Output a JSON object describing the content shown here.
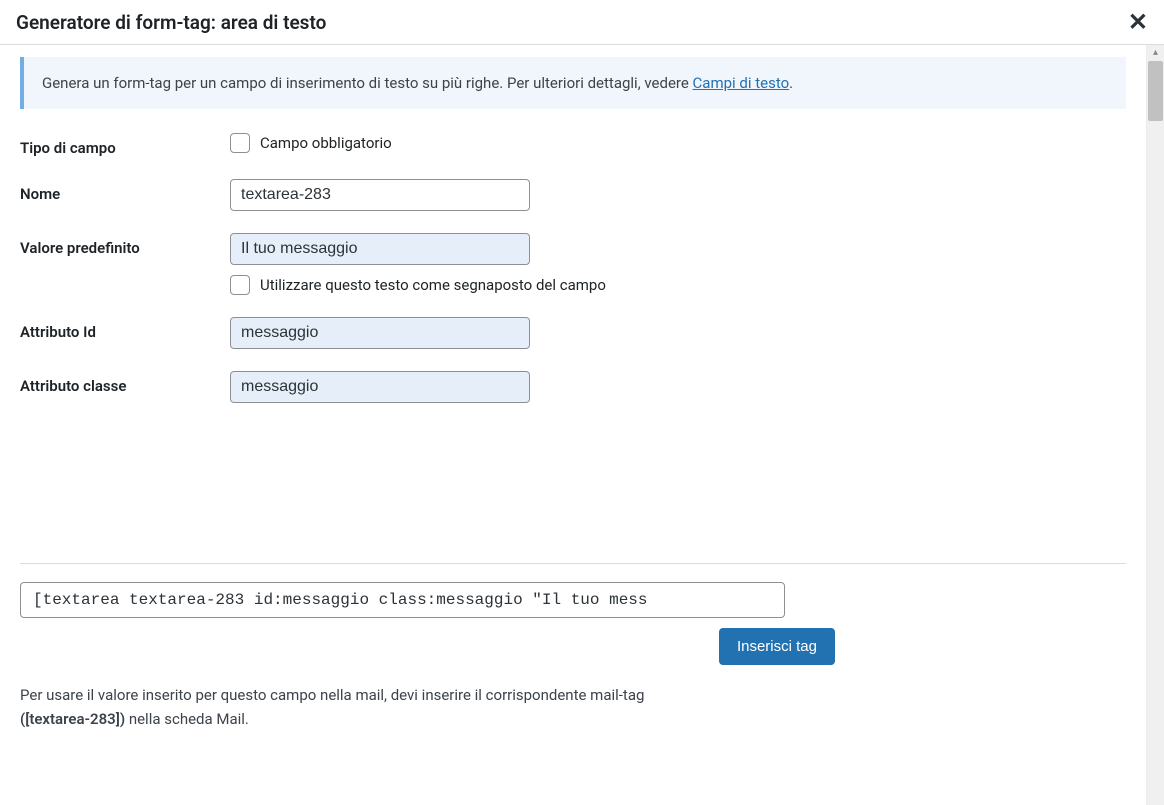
{
  "header": {
    "title": "Generatore di form-tag: area di testo"
  },
  "info": {
    "text_before_link": "Genera un form-tag per un campo di inserimento di testo su più righe. Per ulteriori dettagli, vedere ",
    "link_text": "Campi di testo",
    "text_after_link": "."
  },
  "fields": {
    "field_type": {
      "label": "Tipo di campo",
      "checkbox_label": "Campo obbligatorio"
    },
    "name": {
      "label": "Nome",
      "value": "textarea-283"
    },
    "default_value": {
      "label": "Valore predefinito",
      "value": "Il tuo messaggio",
      "placeholder_checkbox_label": "Utilizzare questo testo come segnaposto del campo"
    },
    "id_attr": {
      "label": "Attributo Id",
      "value": "messaggio"
    },
    "class_attr": {
      "label": "Attributo classe",
      "value": "messaggio"
    }
  },
  "output": {
    "code": "[textarea textarea-283 id:messaggio class:messaggio \"Il tuo mess",
    "insert_button": "Inserisci tag"
  },
  "footer": {
    "text_line1": "Per usare il valore inserito per questo campo nella mail, devi inserire il corrispondente mail-tag",
    "mail_tag": "([textarea-283])",
    "text_line2_suffix": " nella scheda Mail."
  }
}
